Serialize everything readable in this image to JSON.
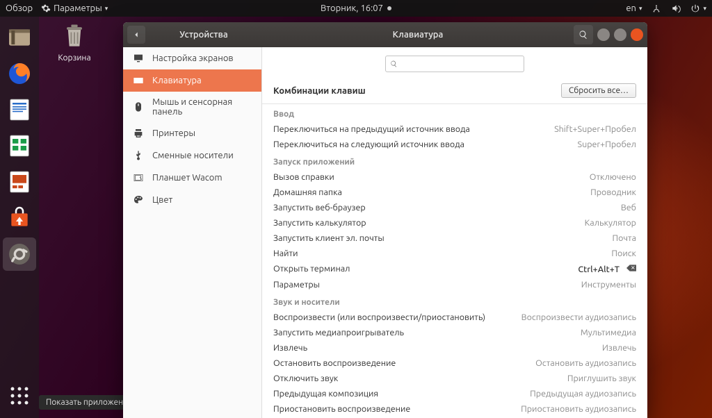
{
  "topbar": {
    "activities": "Обзор",
    "app_label": "Параметры",
    "clock": "Вторник, 16:07",
    "lang": "en"
  },
  "desktop": {
    "trash_label": "Корзина"
  },
  "tooltip": "Показать приложения",
  "window": {
    "sidebar_title": "Устройства",
    "title": "Клавиатура",
    "sidebar": [
      {
        "label": "Настройка экранов"
      },
      {
        "label": "Клавиатура"
      },
      {
        "label": "Мышь и сенсорная панель"
      },
      {
        "label": "Принтеры"
      },
      {
        "label": "Сменные носители"
      },
      {
        "label": "Планшет Wacom"
      },
      {
        "label": "Цвет"
      }
    ],
    "search_placeholder": "",
    "header": "Комбинации клавиш",
    "reset_button": "Сбросить все…",
    "sections": [
      {
        "title": "Ввод",
        "rows": [
          {
            "label": "Переключиться на предыдущий источник ввода",
            "value": "Shift+Super+Пробел"
          },
          {
            "label": "Переключиться на следующий источник ввода",
            "value": "Super+Пробел"
          }
        ]
      },
      {
        "title": "Запуск приложений",
        "rows": [
          {
            "label": "Вызов справки",
            "value": "Отключено"
          },
          {
            "label": "Домашняя папка",
            "value": "Проводник"
          },
          {
            "label": "Запустить веб-браузер",
            "value": "Веб"
          },
          {
            "label": "Запустить калькулятор",
            "value": "Калькулятор"
          },
          {
            "label": "Запустить клиент эл. почты",
            "value": "Почта"
          },
          {
            "label": "Найти",
            "value": "Поиск"
          },
          {
            "label": "Открыть терминал",
            "value": "Ctrl+Alt+T",
            "strong": true,
            "deletable": true
          },
          {
            "label": "Параметры",
            "value": "Инструменты"
          }
        ]
      },
      {
        "title": "Звук и носители",
        "rows": [
          {
            "label": "Воспроизвести (или воспроизвести/приостановить)",
            "value": "Воспроизвести аудиозапись"
          },
          {
            "label": "Запустить медиапроигрыватель",
            "value": "Мультимедиа"
          },
          {
            "label": "Извлечь",
            "value": "Извлечь"
          },
          {
            "label": "Остановить воспроизведение",
            "value": "Остановить аудиозапись"
          },
          {
            "label": "Отключить звук",
            "value": "Приглушить звук"
          },
          {
            "label": "Предыдущая композиция",
            "value": "Предыдущая аудиозапись"
          },
          {
            "label": "Приостановить воспроизведение",
            "value": "Приостановить аудиозапись"
          }
        ]
      }
    ]
  }
}
